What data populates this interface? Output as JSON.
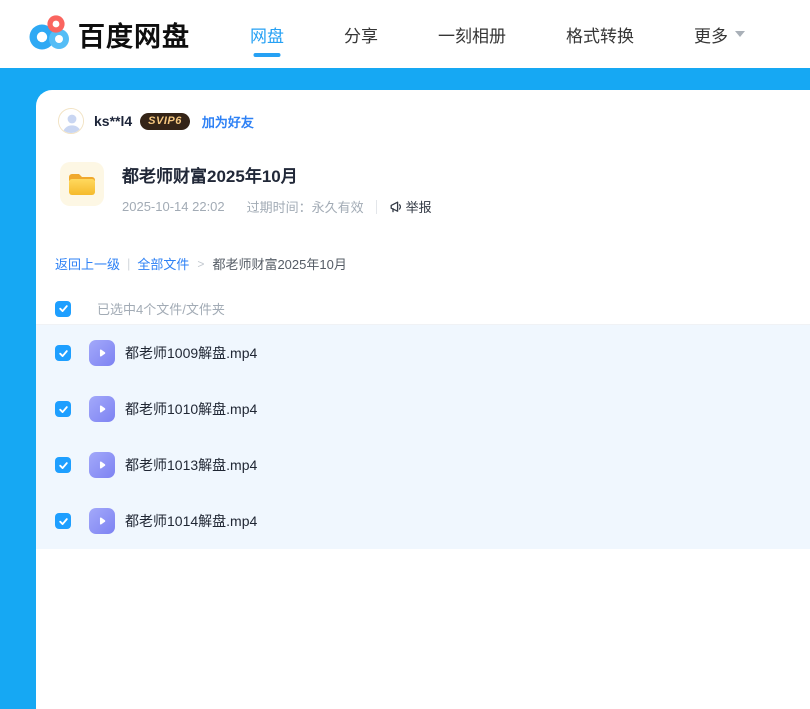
{
  "nav": {
    "logo_text": "百度网盘",
    "tabs": [
      {
        "label": "网盘",
        "active": true
      },
      {
        "label": "分享",
        "active": false
      },
      {
        "label": "一刻相册",
        "active": false
      },
      {
        "label": "格式转换",
        "active": false
      },
      {
        "label": "更多",
        "active": false,
        "has_dropdown": true
      }
    ]
  },
  "share": {
    "username": "ks**l4",
    "vip_badge": "SVIP6",
    "add_friend_label": "加为好友",
    "folder_title": "都老师财富2025年10月",
    "share_time": "2025-10-14 22:02",
    "expire_text": "过期时间：永久有效",
    "report_label": "举报"
  },
  "breadcrumb": {
    "back_label": "返回上一级",
    "sep1": "|",
    "all_files_label": "全部文件",
    "sep2": ">",
    "current": "都老师财富2025年10月"
  },
  "selection": {
    "checked": true,
    "text": "已选中4个文件/文件夹"
  },
  "files": [
    {
      "name": "都老师1009解盘.mp4",
      "type": "video",
      "checked": true
    },
    {
      "name": "都老师1010解盘.mp4",
      "type": "video",
      "checked": true
    },
    {
      "name": "都老师1013解盘.mp4",
      "type": "video",
      "checked": true
    },
    {
      "name": "都老师1014解盘.mp4",
      "type": "video",
      "checked": true
    }
  ],
  "colors": {
    "band_blue": "#16a8f3",
    "accent_tab": "#26a1f4",
    "link_blue": "#2e81f5",
    "checkbox_blue": "#1e9fff",
    "row_highlight": "#f0f7fe",
    "video_icon_purple": "#7d82f2",
    "badge_bg": "#342417",
    "badge_text": "#f5c77e",
    "folder_yellow": "#f9c535"
  }
}
